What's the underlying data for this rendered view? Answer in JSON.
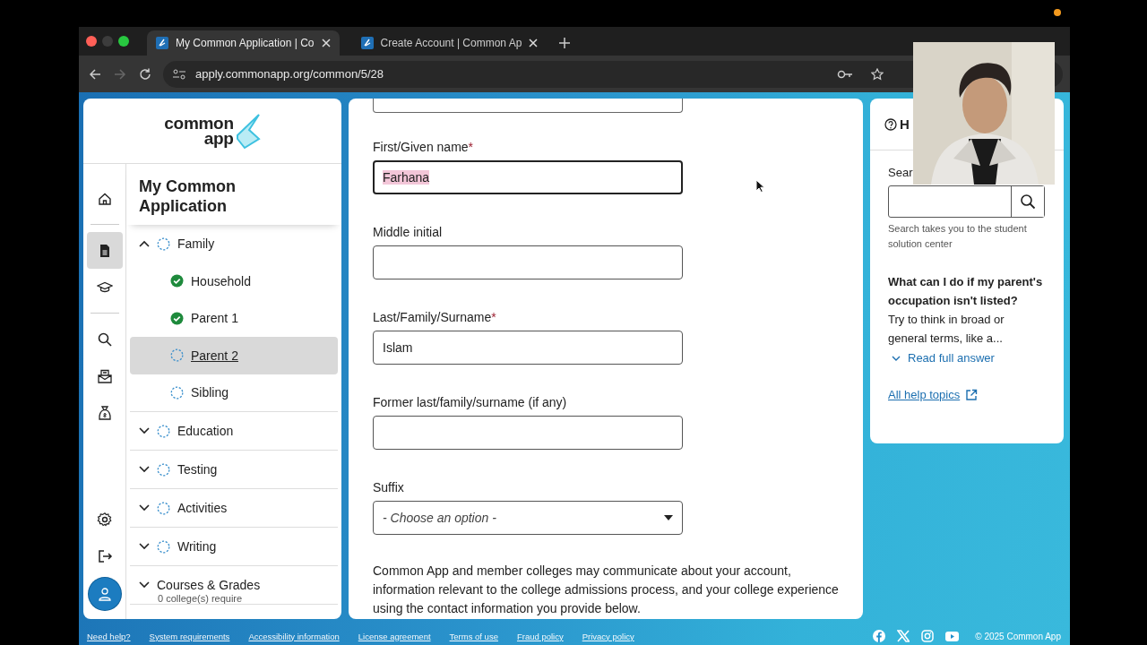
{
  "browser": {
    "tabs": [
      {
        "title": "My Common Application | Co",
        "selected": true
      },
      {
        "title": "Create Account | Common Ap",
        "selected": false
      }
    ],
    "url": "apply.commonapp.org/common/5/28"
  },
  "sidebar": {
    "logo": [
      "common",
      "app"
    ],
    "rail": [
      {
        "kind": "home",
        "selected": false
      },
      {
        "kind": "document",
        "selected": true
      },
      {
        "kind": "cap",
        "selected": false
      },
      {
        "kind": "search",
        "selected": false
      },
      {
        "kind": "mail",
        "selected": false
      },
      {
        "kind": "bag",
        "selected": false
      },
      {
        "kind": "gear",
        "selected": false
      },
      {
        "kind": "logout",
        "selected": false
      },
      {
        "kind": "avatar",
        "selected": false
      }
    ],
    "title": "My Common Application",
    "sections": [
      {
        "label": "Family",
        "expanded": true,
        "complete": false,
        "children": [
          {
            "label": "Household",
            "complete": true,
            "selected": false
          },
          {
            "label": "Parent 1",
            "complete": true,
            "selected": false
          },
          {
            "label": "Parent 2",
            "complete": false,
            "selected": true
          },
          {
            "label": "Sibling",
            "complete": false,
            "selected": false
          }
        ]
      },
      {
        "label": "Education",
        "expanded": false,
        "complete": false
      },
      {
        "label": "Testing",
        "expanded": false,
        "complete": false
      },
      {
        "label": "Activities",
        "expanded": false,
        "complete": false
      },
      {
        "label": "Writing",
        "expanded": false,
        "complete": false
      },
      {
        "label": "Courses & Grades",
        "expanded": false,
        "note": "0 college(s) require"
      }
    ]
  },
  "form": {
    "fields": [
      {
        "kind": "text",
        "label": "First/Given name",
        "required_mark": "*",
        "value": "Farhana",
        "focused": true
      },
      {
        "kind": "text",
        "label": "Middle initial",
        "focused": false
      },
      {
        "kind": "text",
        "label": "Last/Family/Surname",
        "required_mark": "*",
        "value": "Islam",
        "focused": false
      },
      {
        "kind": "text",
        "label": "Former last/family/surname (if any)",
        "focused": false
      },
      {
        "kind": "select",
        "label": "Suffix",
        "placeholder": "- Choose an option -",
        "focused": false
      }
    ],
    "notice": "Common App and member colleges may communicate about your account, information relevant to the college admissions process, and your college experience using the contact information you provide below."
  },
  "help": {
    "title": "H",
    "search_label": "Sear",
    "search_hint": "Search takes you to the student solution center",
    "question": "What can I do if my parent's occupation isn't listed?",
    "answer": "Try to think in broad or general terms, like a...",
    "read_more": "Read full answer",
    "all_topics": "All help topics"
  },
  "footer": {
    "links": [
      "Need help?",
      "System requirements",
      "Accessibility information",
      "License agreement",
      "Terms of use",
      "Fraud policy",
      "Privacy policy"
    ],
    "copyright": "© 2025 Common App"
  }
}
